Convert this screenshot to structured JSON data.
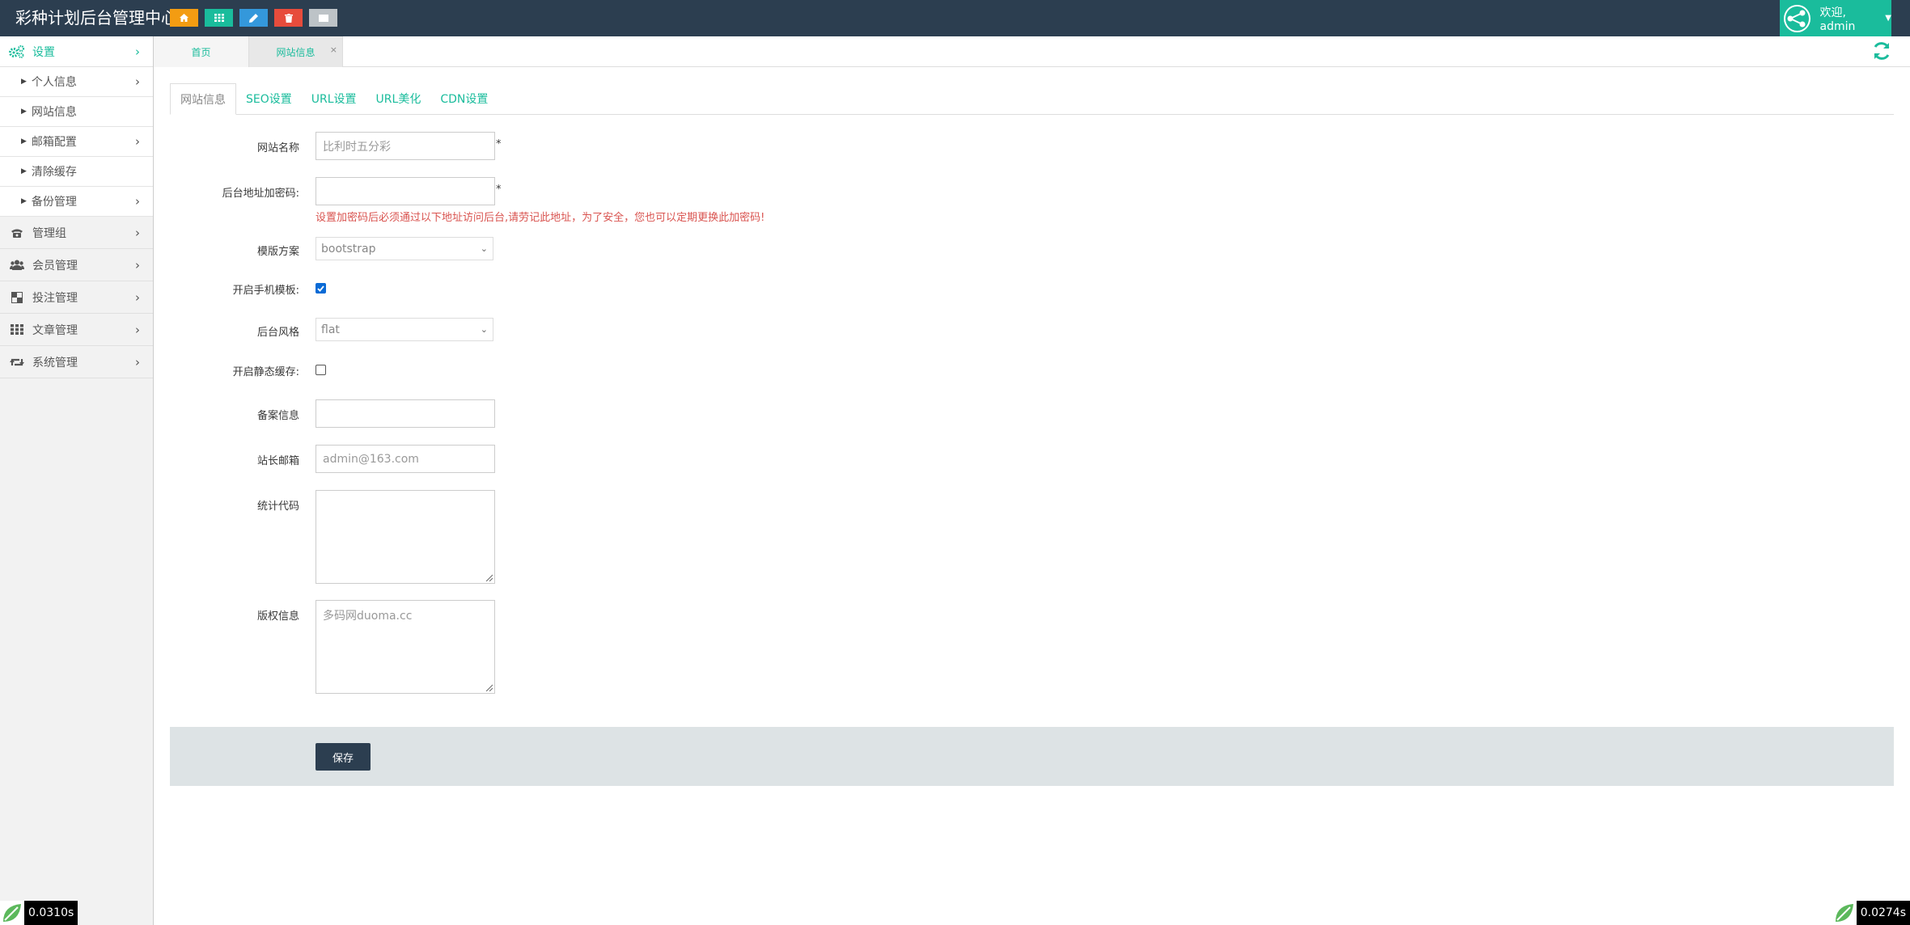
{
  "header": {
    "brand": "彩种计划后台管理中心",
    "shortcut_colors": [
      "#f39c12",
      "#1abc9c",
      "#3498db",
      "#e74c3c",
      "#bdc3c7"
    ],
    "shortcut_icons": [
      "home-icon",
      "grid-icon",
      "pencil-icon",
      "trash-icon",
      "list-icon"
    ],
    "user_greeting": "欢迎, admin"
  },
  "sidebar": {
    "head": "设置",
    "items": [
      {
        "label": "个人信息",
        "has_chevron": true
      },
      {
        "label": "网站信息",
        "has_chevron": false
      },
      {
        "label": "邮箱配置",
        "has_chevron": true
      },
      {
        "label": "清除缓存",
        "has_chevron": false
      },
      {
        "label": "备份管理",
        "has_chevron": true
      }
    ],
    "groups": [
      {
        "label": "管理组",
        "icon": "phone-icon"
      },
      {
        "label": "会员管理",
        "icon": "users-icon"
      },
      {
        "label": "投注管理",
        "icon": "checker-icon"
      },
      {
        "label": "文章管理",
        "icon": "grid-icon"
      },
      {
        "label": "系统管理",
        "icon": "retweet-icon"
      }
    ]
  },
  "page_tabs": {
    "home": "首页",
    "site": "网站信息",
    "close": "×"
  },
  "form_tabs": [
    "网站信息",
    "SEO设置",
    "URL设置",
    "URL美化",
    "CDN设置"
  ],
  "form": {
    "site_name_label": "网站名称",
    "site_name_placeholder": "比利时五分彩",
    "required_mark": "*",
    "admin_pw_label": "后台地址加密码:",
    "admin_pw_value": "",
    "admin_pw_warning": "设置加密码后必须通过以下地址访问后台,请劳记此地址，为了安全，您也可以定期更换此加密码!",
    "template_label": "模版方案",
    "template_value": "bootstrap",
    "mobile_label": "开启手机模板:",
    "mobile_checked": true,
    "style_label": "后台风格",
    "style_value": "flat",
    "static_cache_label": "开启静态缓存:",
    "static_cache_checked": false,
    "icp_label": "备案信息",
    "icp_value": "",
    "email_label": "站长邮箱",
    "email_placeholder": "admin@163.com",
    "stats_label": "统计代码",
    "stats_value": "",
    "copyright_label": "版权信息",
    "copyright_placeholder": "多码网duoma.cc",
    "save_label": "保存"
  },
  "timers": {
    "left": "0.0310s",
    "right": "0.0274s"
  }
}
